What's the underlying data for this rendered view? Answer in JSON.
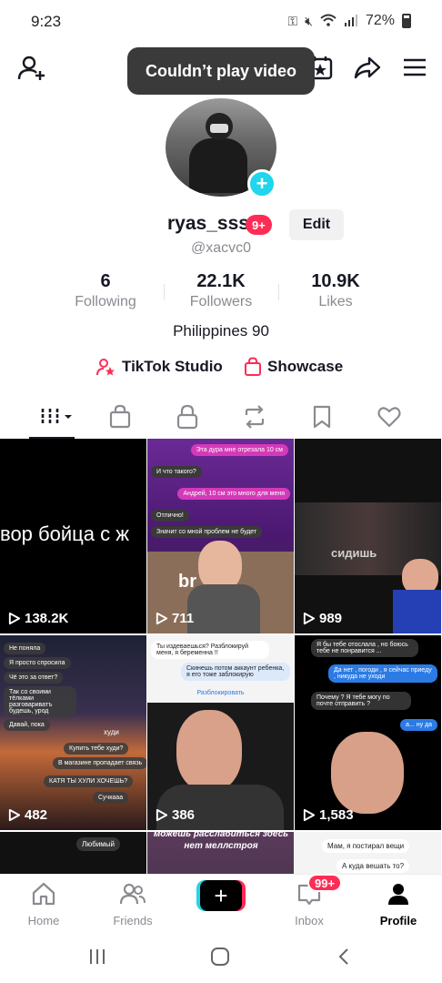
{
  "status_bar": {
    "time": "9:23",
    "battery": "72%"
  },
  "toast": {
    "text": "Couldn’t play video"
  },
  "profile": {
    "username": "ryas_sss",
    "badge": "9+",
    "edit_label": "Edit",
    "handle": "@xacvc0",
    "bio": "Philippines 90"
  },
  "stats": [
    {
      "value": "6",
      "label": "Following"
    },
    {
      "value": "22.1K",
      "label": "Followers"
    },
    {
      "value": "10.9K",
      "label": "Likes"
    }
  ],
  "links": {
    "studio": "TikTok Studio",
    "showcase": "Showcase"
  },
  "videos": [
    {
      "views": "138.2K",
      "caption": "вор бойца с ж"
    },
    {
      "views": "711",
      "caption": "br",
      "bubbles": [
        "Эта дура мне отрезала 10 см",
        "И что такого?",
        "Андрей, 10 см это много для меня",
        "Отлично!",
        "Значит со мной проблем не будет"
      ]
    },
    {
      "views": "989",
      "caption": "сидишь"
    },
    {
      "views": "482",
      "caption": "худи",
      "bubbles": [
        "Не поняла",
        "Я просто спросила",
        "Чё это за ответ?",
        "Так со своими тёлками разговариватъ будешь, урод",
        "Давай, пока",
        "Купить тебе худи?",
        "В магазине пропадает связь",
        "КАТЯ ТЫ ХУЛИ ХОЧЕШЬ?",
        "Сучкааа"
      ]
    },
    {
      "views": "386",
      "bubbles": [
        "Ты издеваешься? Разблокируй меня, я беременна !!",
        "Скинешь потом аккаунт ребенка, я его тоже заблокирую",
        "Разблокировать"
      ]
    },
    {
      "views": "1,583",
      "bubbles": [
        "Я бы тебе отослала , но боюсь тебе не понравится ...",
        "Да нет , погоди , я сейчас приеду , никуда не уходи",
        "Почему ? Я тебе могу по почте отправить ?",
        "а... ну да"
      ]
    },
    {
      "caption": "Любимый"
    },
    {
      "caption": "можешь расслабиться здесь нет меллстроя"
    },
    {
      "bubbles": [
        "Мам, я постирал вещи",
        "А куда вешать то?"
      ]
    }
  ],
  "bottom_nav": {
    "home": "Home",
    "friends": "Friends",
    "inbox": "Inbox",
    "inbox_badge": "99+",
    "profile": "Profile"
  }
}
